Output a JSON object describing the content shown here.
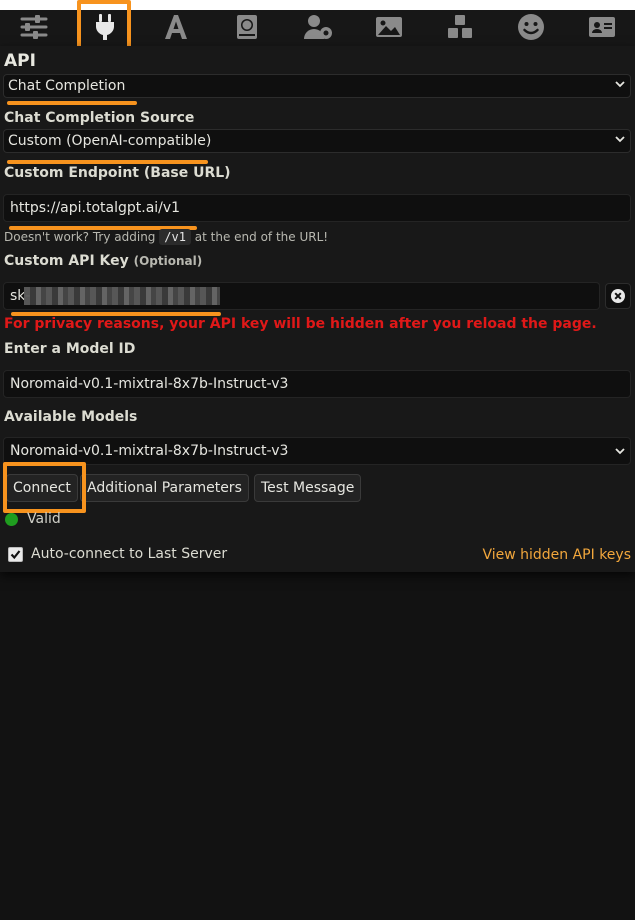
{
  "toolbar": {
    "icons": [
      "sliders-icon",
      "plug-icon",
      "font-icon",
      "globe-book-icon",
      "user-gear-icon",
      "image-icon",
      "cubes-icon",
      "smiley-icon",
      "id-card-icon"
    ],
    "active_icon": "plug-icon"
  },
  "api": {
    "heading": "API",
    "selected": "Chat Completion"
  },
  "source": {
    "label": "Chat Completion Source",
    "selected": "Custom (OpenAI-compatible)"
  },
  "endpoint": {
    "label": "Custom Endpoint (Base URL)",
    "value": "https://api.totalgpt.ai/v1",
    "hint_before": "Doesn't work? Try adding",
    "hint_code": "/v1",
    "hint_after": "at the end of the URL!"
  },
  "api_key": {
    "label": "Custom API Key",
    "optional": "(Optional)",
    "value_prefix": "sk-",
    "privacy_warning": "For privacy reasons, your API key will be hidden after you reload the page."
  },
  "model_id": {
    "label": "Enter a Model ID",
    "value": "Noromaid-v0.1-mixtral-8x7b-Instruct-v3"
  },
  "available_models": {
    "label": "Available Models",
    "selected": "Noromaid-v0.1-mixtral-8x7b-Instruct-v3"
  },
  "buttons": {
    "connect": "Connect",
    "additional": "Additional Parameters",
    "test": "Test Message"
  },
  "status": {
    "text": "Valid",
    "color": "#1f9d1f"
  },
  "auto_connect": {
    "label": "Auto-connect to Last Server",
    "checked": true
  },
  "view_keys_link": "View hidden API keys",
  "colors": {
    "highlight": "#f7931e",
    "warning": "#e01818",
    "link": "#f2a73c"
  }
}
